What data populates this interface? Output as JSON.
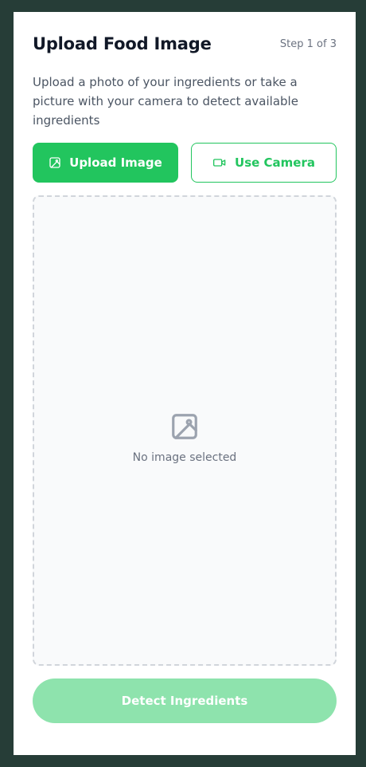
{
  "header": {
    "title": "Upload Food Image",
    "step": "Step 1 of 3"
  },
  "description": "Upload a photo of your ingredients or take a picture with your camera to detect available ingredients",
  "actions": {
    "upload_label": "Upload Image",
    "upload_icon": "image-icon",
    "camera_label": "Use Camera",
    "camera_icon": "video-camera-icon"
  },
  "dropzone": {
    "icon": "image-placeholder-icon",
    "empty_text": "No image selected"
  },
  "detect_button": {
    "label": "Detect Ingredients",
    "state": "disabled"
  },
  "colors": {
    "accent": "#22c55e",
    "accent_disabled": "#8ee3ad",
    "background": "#263d37",
    "card": "#ffffff",
    "dropzone_bg": "#f9fafb",
    "dropzone_border": "#d1d5db",
    "title": "#111827",
    "body_text": "#4b5563",
    "muted_text": "#6b7280"
  }
}
